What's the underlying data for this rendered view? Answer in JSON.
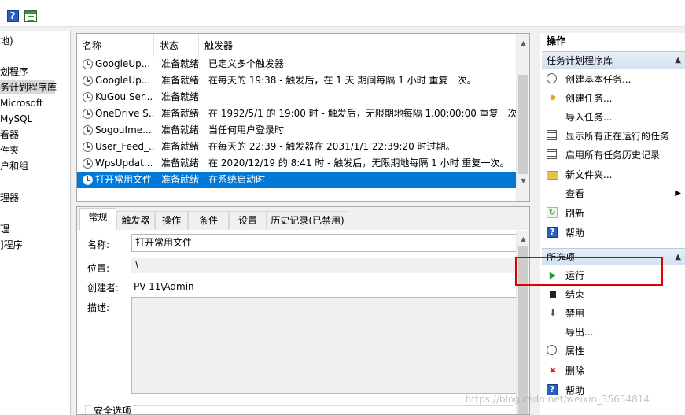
{
  "toolbar": {
    "help_icon": "help-icon",
    "view_icon": "grid-view-icon"
  },
  "left_tree": {
    "items": [
      "地)",
      "划程序",
      "务计划程序库",
      "Microsoft",
      "MySQL",
      "看器",
      "件夹",
      "户和组",
      "理器",
      "理",
      "]程序"
    ]
  },
  "task_list": {
    "columns": [
      "名称",
      "状态",
      "触发器"
    ],
    "rows": [
      {
        "name": "GoogleUp...",
        "status": "准备就绪",
        "trigger": "已定义多个触发器"
      },
      {
        "name": "GoogleUp...",
        "status": "准备就绪",
        "trigger": "在每天的 19:38 - 触发后，在 1 天 期间每隔 1 小时 重复一次。"
      },
      {
        "name": "KuGou Ser...",
        "status": "准备就绪",
        "trigger": ""
      },
      {
        "name": "OneDrive S...",
        "status": "准备就绪",
        "trigger": "在 1992/5/1 的 19:00 时 - 触发后，无限期地每隔 1.00:00:00 重复一次。"
      },
      {
        "name": "SogouIme...",
        "status": "准备就绪",
        "trigger": "当任何用户登录时"
      },
      {
        "name": "User_Feed_...",
        "status": "准备就绪",
        "trigger": "在每天的 22:39 - 触发器在 2031/1/1 22:39:20 时过期。"
      },
      {
        "name": "WpsUpdat...",
        "status": "准备就绪",
        "trigger": "在 2020/12/19 的 8:41 时 - 触发后，无限期地每隔 1 小时 重复一次。"
      },
      {
        "name": "打开常用文件",
        "status": "准备就绪",
        "trigger": "在系统启动时"
      }
    ]
  },
  "details": {
    "tabs": [
      "常规",
      "触发器",
      "操作",
      "条件",
      "设置",
      "历史记录(已禁用)"
    ],
    "name_label": "名称:",
    "name_value": "打开常用文件",
    "location_label": "位置:",
    "location_value": "\\",
    "author_label": "创建者:",
    "author_value": "PV-11\\Admin",
    "desc_label": "描述:",
    "security_label": "安全选项"
  },
  "actions": {
    "title": "操作",
    "group1": {
      "title": "任务计划程序库",
      "items": [
        {
          "label": "创建基本任务...",
          "icon": "basic-task-icon"
        },
        {
          "label": "创建任务...",
          "icon": "create-task-icon"
        },
        {
          "label": "导入任务...",
          "icon": ""
        },
        {
          "label": "显示所有正在运行的任务",
          "icon": "running-tasks-icon"
        },
        {
          "label": "启用所有任务历史记录",
          "icon": "history-icon"
        },
        {
          "label": "新文件夹...",
          "icon": "folder-icon"
        },
        {
          "label": "查看",
          "icon": ""
        },
        {
          "label": "刷新",
          "icon": "refresh-icon"
        },
        {
          "label": "帮助",
          "icon": "help-icon"
        }
      ]
    },
    "group2": {
      "title": "所选项",
      "items": [
        {
          "label": "运行",
          "icon": "play-icon"
        },
        {
          "label": "结束",
          "icon": "stop-icon"
        },
        {
          "label": "禁用",
          "icon": "disable-icon"
        },
        {
          "label": "导出...",
          "icon": ""
        },
        {
          "label": "属性",
          "icon": "properties-icon"
        },
        {
          "label": "删除",
          "icon": "delete-icon"
        },
        {
          "label": "帮助",
          "icon": "help-icon"
        }
      ]
    }
  },
  "watermark": "https://blog.csdn.net/weixin_35654814",
  "colors": {
    "selection": "#0078d7",
    "highlight_box": "#e00000",
    "group_header": "#d4e1f1"
  }
}
